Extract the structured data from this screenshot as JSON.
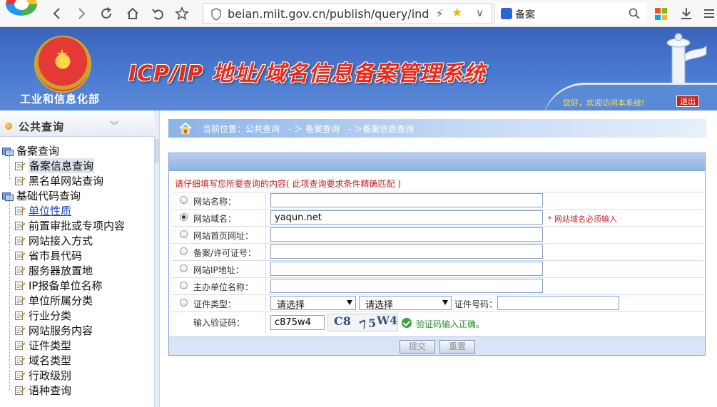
{
  "browser": {
    "url": "beian.miit.gov.cn/publish/query/indexFirst.action",
    "search_text": "备案",
    "icons": [
      "back-icon",
      "forward-icon",
      "refresh-icon",
      "home-icon",
      "undo-icon",
      "star-icon",
      "shield-icon",
      "bolt-icon",
      "favorite-star-icon",
      "chevron-down-icon",
      "paw-icon",
      "search-icon",
      "apps-icon",
      "download-icon",
      "menu-icon"
    ]
  },
  "banner": {
    "ministry": "工业和信息化部",
    "title": "ICP/IP 地址/域名信息备案管理系统",
    "welcome": "您好，欢迎访问本系统!",
    "logout": "退出"
  },
  "sidebar": {
    "header": "公共查询",
    "tree": [
      {
        "label": "备案查询",
        "group": true
      },
      {
        "label": "备案信息查询",
        "group": false,
        "selected": true
      },
      {
        "label": "黑名单网站查询",
        "group": false
      },
      {
        "label": "基础代码查询",
        "group": true
      },
      {
        "label": "单位性质",
        "group": false,
        "link": true
      },
      {
        "label": "前置审批或专项内容",
        "group": false
      },
      {
        "label": "网站接入方式",
        "group": false
      },
      {
        "label": "省市县代码",
        "group": false
      },
      {
        "label": "服务器放置地",
        "group": false
      },
      {
        "label": "IP报备单位名称",
        "group": false
      },
      {
        "label": "单位所属分类",
        "group": false
      },
      {
        "label": "行业分类",
        "group": false
      },
      {
        "label": "网站服务内容",
        "group": false
      },
      {
        "label": "证件类型",
        "group": false
      },
      {
        "label": "域名类型",
        "group": false
      },
      {
        "label": "行政级别",
        "group": false
      },
      {
        "label": "语种查询",
        "group": false
      }
    ]
  },
  "breadcrumb": {
    "text": "当前位置：公共查询　- ＞ 备案查询　- ＞备案信息查询"
  },
  "form": {
    "note": "请仔细填写您所要查询的内容( 此项查询要求条件精确匹配 )",
    "fields": [
      {
        "label": "网站名称：",
        "value": "",
        "checked": false
      },
      {
        "label": "网站域名：",
        "value": "yaqun.net",
        "checked": true,
        "hint": "* 网站域名必须输入"
      },
      {
        "label": "网站首页网址：",
        "value": "",
        "checked": false
      },
      {
        "label": "备案/许可证号：",
        "value": "",
        "checked": false
      },
      {
        "label": "网站IP地址：",
        "value": "",
        "checked": false
      },
      {
        "label": "主办单位名称：",
        "value": "",
        "checked": false
      }
    ],
    "cert": {
      "label": "证件类型：",
      "select1": "请选择",
      "select2": "请选择",
      "number_label": "证件号码：",
      "number_value": ""
    },
    "captcha": {
      "label": "输入验证码：",
      "value": "c875w4",
      "image_text": [
        "C8",
        "7",
        "5",
        "W4"
      ],
      "ok_text": "验证码输入正确。"
    },
    "submit": "提交",
    "reset": "重置"
  },
  "colors": {
    "banner_blue": "#4a7ad0",
    "title_red": "#e8291c",
    "hint_red": "#c72020",
    "ok_green": "#2a8a2a"
  }
}
